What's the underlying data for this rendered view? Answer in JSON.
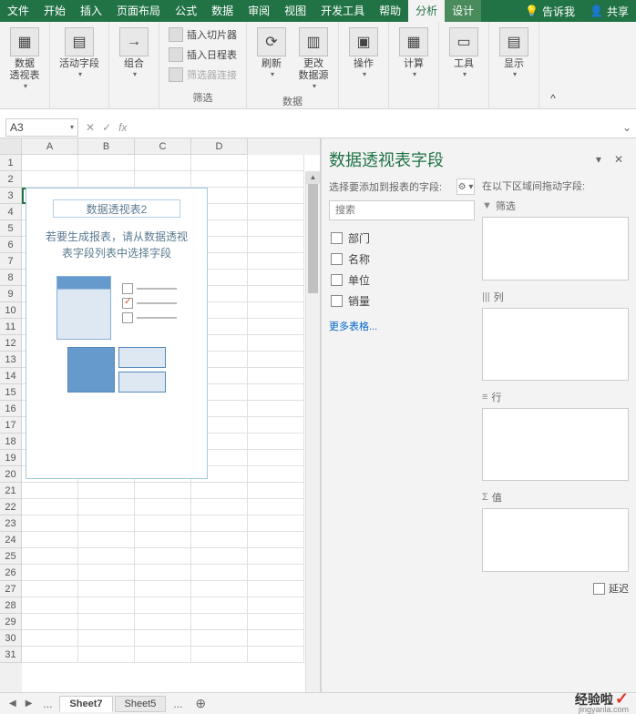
{
  "tabs": {
    "file": "文件",
    "home": "开始",
    "insert": "插入",
    "page_layout": "页面布局",
    "formulas": "公式",
    "data": "数据",
    "review": "审阅",
    "view": "视图",
    "developer": "开发工具",
    "help": "帮助",
    "analyze": "分析",
    "design": "设计",
    "tell_me": "告诉我",
    "share": "共享"
  },
  "ribbon": {
    "pivot_table": "数据\n透视表",
    "active_field": "活动字段",
    "group": "组合",
    "insert_slicer": "插入切片器",
    "insert_timeline": "插入日程表",
    "filter_connections": "筛选器连接",
    "filter_label": "筛选",
    "refresh": "刷新",
    "change_source": "更改\n数据源",
    "data_label": "数据",
    "actions": "操作",
    "calculations": "计算",
    "tools": "工具",
    "show": "显示"
  },
  "formula_bar": {
    "cell_ref": "A3",
    "fx": "fx"
  },
  "columns": [
    "A",
    "B",
    "C",
    "D"
  ],
  "rows": [
    "1",
    "2",
    "3",
    "4",
    "5",
    "6",
    "7",
    "8",
    "9",
    "10",
    "11",
    "12",
    "13",
    "14",
    "15",
    "16",
    "17",
    "18",
    "19",
    "20",
    "21",
    "22",
    "23",
    "24",
    "25",
    "26",
    "27",
    "28",
    "29",
    "30",
    "31"
  ],
  "pivot_placeholder": {
    "title": "数据透视表2",
    "hint_line1": "若要生成报表，请从数据透视",
    "hint_line2": "表字段列表中选择字段"
  },
  "field_pane": {
    "title": "数据透视表字段",
    "choose_label": "选择要添加到报表的字段:",
    "drag_label": "在以下区域间拖动字段:",
    "search_placeholder": "搜索",
    "fields": [
      "部门",
      "名称",
      "单位",
      "销量"
    ],
    "more_tables": "更多表格...",
    "filter_label": "筛选",
    "columns_label": "列",
    "rows_label": "行",
    "values_label": "值",
    "defer": "延迟"
  },
  "sheet_tabs": {
    "active": "Sheet7",
    "other": "Sheet5",
    "dots": "..."
  },
  "watermark": {
    "main": "经验啦",
    "sub": "jingyanla.com"
  }
}
